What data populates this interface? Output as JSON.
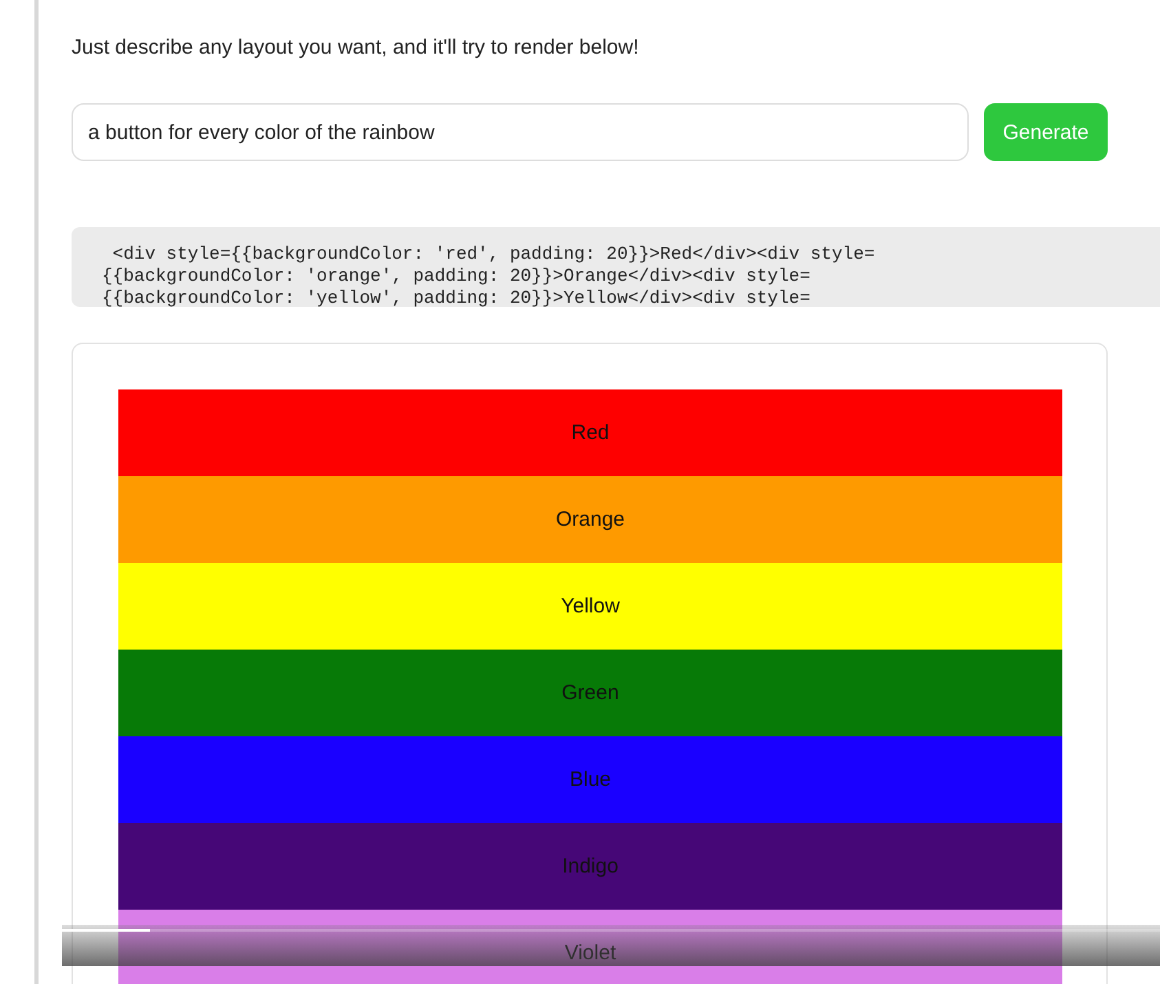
{
  "intro": "Just describe any layout you want, and it'll try to render below!",
  "prompt": {
    "value": "a button for every color of the rainbow"
  },
  "generate_button": "Generate",
  "code_lines": [
    "<div style={{backgroundColor: 'red', padding: 20}}>Red</div><div style=",
    "{{backgroundColor: 'orange', padding: 20}}>Orange</div><div style=",
    "{{backgroundColor: 'yellow', padding: 20}}>Yellow</div><div style="
  ],
  "stripes": [
    {
      "label": "Red",
      "color": "#fe0000"
    },
    {
      "label": "Orange",
      "color": "#fe9a00"
    },
    {
      "label": "Yellow",
      "color": "#ffff00"
    },
    {
      "label": "Green",
      "color": "#077a07"
    },
    {
      "label": "Blue",
      "color": "#1a00ff"
    },
    {
      "label": "Indigo",
      "color": "#460777"
    },
    {
      "label": "Violet",
      "color": "#d97ee8"
    }
  ],
  "video_progress": {
    "level": 0.08
  }
}
